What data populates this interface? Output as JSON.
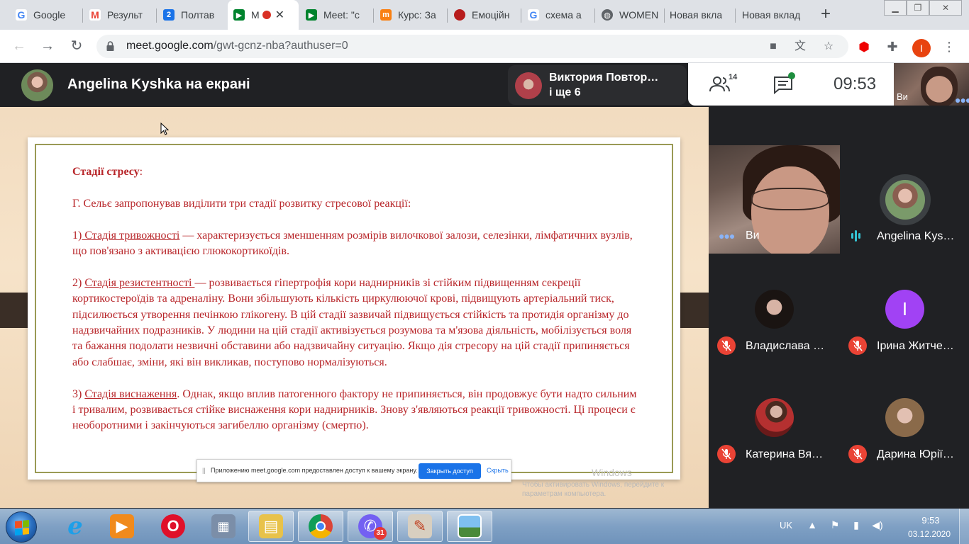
{
  "browser": {
    "tabs": [
      {
        "title": "Google",
        "icon": "google-g-icon",
        "color": "#4285f4"
      },
      {
        "title": "Результ",
        "icon": "gmail-icon",
        "color": "#ea4335"
      },
      {
        "title": "Полтав",
        "icon": "calendar-2-icon",
        "color": "#1a73e8"
      },
      {
        "title": "М",
        "icon": "meet-icon",
        "color": "#00832d"
      },
      {
        "title": "Meet: \"c",
        "icon": "meet-icon",
        "color": "#00832d"
      },
      {
        "title": "Курс: За",
        "icon": "moodle-icon",
        "color": "#f98012"
      },
      {
        "title": "Емоційн",
        "icon": "record-icon",
        "color": "#b71c1c"
      },
      {
        "title": "схема а",
        "icon": "google-g-icon",
        "color": "#4285f4"
      },
      {
        "title": "WOMEN",
        "icon": "globe-icon",
        "color": "#5f6368"
      },
      {
        "title": "Новая вкла",
        "icon": "",
        "color": ""
      },
      {
        "title": "Новая вклад",
        "icon": "",
        "color": ""
      }
    ],
    "url_host": "meet.google.com",
    "url_path": "/gwt-gcnz-nba?authuser=0",
    "profile_initial": "I"
  },
  "meet": {
    "presenter_label": "Angelina Kyshka на екрані",
    "others_line1": "Виктория Повтор…",
    "others_line2": "і ще 6",
    "participant_count": "14",
    "clock": "09:53",
    "self_label": "Ви",
    "participants": [
      {
        "name": "Ви",
        "state": "video"
      },
      {
        "name": "Angelina Kys…",
        "state": "speaking"
      },
      {
        "name": "Владислава …",
        "state": "muted"
      },
      {
        "name": "Ірина Житче…",
        "state": "muted",
        "initial": "І",
        "color": "#a142f4"
      },
      {
        "name": "Катерина Вя…",
        "state": "muted"
      },
      {
        "name": "Дарина Юрії…",
        "state": "muted"
      }
    ]
  },
  "slide": {
    "heading_bold": "Стадії стресу",
    "heading_colon": ":",
    "intro": "Г. Сельє запропонував виділити три стадії розвитку стресової реакції:",
    "s1_num": "1)",
    "s1_term": " Стадія тривожності",
    "s1_text": " — характеризується зменшенням розмірів вилочкової залози, селезінки, лімфатичних вузлів, що пов'язано з активацією глюкокортикоїдів.",
    "s2_num": "2) ",
    "s2_term": "Стадія резистентності ",
    "s2_text": "— розвивається гіпертрофія кори наднирників зі стійким підвищенням секреції кортикостероїдів та адреналіну. Вони збільшують кількість циркулюючої крові, підвищують артеріальний тиск, підсилюється утворення печінкою глікогену. В цій стадії зазвичай підвищується стійкість та протидія організму до надзвичайних подразників. У людини на цій стадії активізується розумова та м'язова діяльність, мобілізується воля та бажання подолати незвичні обставини або надзвичайну ситуацію. Якщо дія стресору на цій стадії припиняється або слабшає, зміни, які він викликав, поступово нормалізуються.",
    "s3_num": "3) ",
    "s3_term": "Стадія виснаження",
    "s3_text": ". Однак, якщо вплив патогенного фактору не припиняється, він продовжує бути надто сильним і тривалим, розвивається стійке виснаження кори наднирників. Знову з'являються реакції тривожності. Ці процеси є необоротними і закінчуються загибеллю організму (смертю).",
    "watermark_title": "Windows",
    "watermark_text": "Чтобы активировать Windows, перейдите к параметрам компьютера.",
    "share_message": "Приложению meet.google.com предоставлен доступ к вашему экрану.",
    "share_stop": "Закрыть доступ",
    "share_hide": "Скрыть"
  },
  "taskbar": {
    "apps": [
      "internet-explorer",
      "media-player",
      "opera",
      "calculator",
      "file-explorer",
      "chrome",
      "viber",
      "paint",
      "photo-viewer"
    ],
    "viber_badge": "31",
    "language": "UK",
    "time": "9:53",
    "date": "03.12.2020"
  }
}
